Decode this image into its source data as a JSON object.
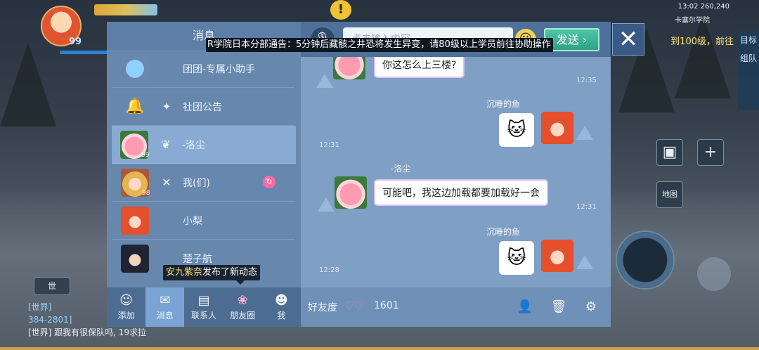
{
  "hud": {
    "player_level": "99",
    "status": "13:02",
    "map_name": "卡塞尔学院",
    "coords": "260,240",
    "quest_text": "到100级，前往",
    "side_tabs": [
      "目标",
      "组队"
    ],
    "alert_glyph": "!",
    "map_btn_label": "地图",
    "chat_lines": [
      "[世界]",
      "384-2801]",
      "[世界] 跟我有很保队吗, 19求拉"
    ],
    "chat_tag": "世"
  },
  "announcement": "R学院日本分部通告：5分钟后藏骸之井恐将发生异变，请80级以上学员前往协助操作",
  "messages_panel": {
    "title": "消息",
    "contacts": [
      {
        "name": "团团-专属小助手",
        "avatar": "blue-dragon",
        "tag_icon": ""
      },
      {
        "name": "社团公告",
        "avatar": "bell",
        "tag_icon": "star"
      },
      {
        "name": "-洛尘",
        "avatar": "pig",
        "level": "99",
        "tag_icon": "leaf",
        "active": true
      },
      {
        "name": "我(们)",
        "avatar": "blonde-girl",
        "level": "98",
        "tag_icon": "cross-swords",
        "badge": "↻"
      },
      {
        "name": "小梨",
        "avatar": "red-hair-girl",
        "tag_icon": ""
      },
      {
        "name": "楚子航",
        "avatar": "dark-hair-boy",
        "tag_icon": ""
      }
    ],
    "tooltip": {
      "user": "安九紫奈",
      "text": "发布了新动态"
    },
    "nav": [
      {
        "label": "添加",
        "icon": "add-user-icon"
      },
      {
        "label": "消息",
        "icon": "mail-icon",
        "active": true
      },
      {
        "label": "联系人",
        "icon": "contacts-icon"
      },
      {
        "label": "朋友圈",
        "icon": "moments-icon"
      },
      {
        "label": "我",
        "icon": "me-icon"
      }
    ]
  },
  "chat": {
    "input_placeholder": "点击输入内容",
    "send_label": "发送",
    "close_label": "✕",
    "messages": [
      {
        "side": "left",
        "text": "你这怎么上三楼?",
        "time": "12:35"
      },
      {
        "side": "right",
        "sender": "沉睡的鱼",
        "content": "sticker-cat",
        "time": "12:31"
      },
      {
        "side": "left",
        "sender": "-洛尘",
        "text": "可能吧，我这边加载都要加载好一会",
        "time": "12:31"
      },
      {
        "side": "right",
        "sender": "沉睡的鱼",
        "content": "sticker-cat",
        "time": "12:28"
      }
    ],
    "footer": {
      "friendship_label": "好友度",
      "friendship_value": "1601"
    }
  },
  "colors": {
    "panel_blue": "#6787ad",
    "chat_blue": "#7f9fc4",
    "send_green": "#2ea284",
    "active_item": "#89abd3"
  }
}
